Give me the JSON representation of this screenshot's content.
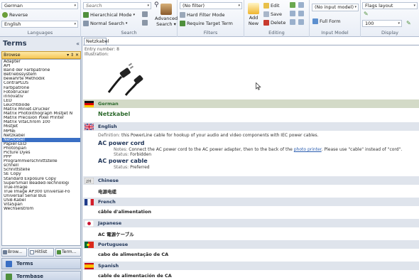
{
  "ribbon": {
    "languages": {
      "source_lang": "German",
      "reverse_label": "Reverse",
      "target_lang": "English",
      "group_label": "Languages"
    },
    "search": {
      "placeholder": "Search",
      "hierarchical_label": "Hierarchical Mode",
      "normal_search_label": "Normal Search",
      "advanced_label": "Advanced",
      "advanced_label2": "Search",
      "group_label": "Search"
    },
    "filters": {
      "filter_value": "(No filter)",
      "hard_filter_label": "Hard Filter Mode",
      "require_target_label": "Require Target Term",
      "group_label": "Filters"
    },
    "editing": {
      "add_label": "Add",
      "new_label": "New",
      "edit_label": "Edit",
      "save_label": "Save",
      "delete_label": "Delete",
      "group_label": "Editing"
    },
    "input_model": {
      "model_value": "(No input model)",
      "full_form_label": "Full Form",
      "group_label": "Input Model"
    },
    "display": {
      "layout_value": "Flags layout",
      "zoom_value": "100",
      "group_label": "Display"
    }
  },
  "leftpane": {
    "title": "Terms",
    "collapse_glyph": "«",
    "browse_label": "Browse",
    "browse_controls": "▾ ⇕ ✕",
    "items": [
      "Adapter",
      "API",
      "Band der Farbpatrone",
      "Betriebssystem",
      "bewährte Methodik",
      "ContraPLUS",
      "Farbpatrone",
      "Fotodrucker",
      "innovativ",
      "LED",
      "Leuchtdiode",
      "Matrix Miniet-Drucker",
      "Matrix Photolithograph MistJet N",
      "Matrix Precision Pixel Printer",
      "Matrix VitaChrom 100",
      "MistJet",
      "MPNE",
      "Netzkabel",
      "Netzkabel",
      "Papier-LED",
      "PhotoSpan",
      "Picture Dyes",
      "PPP",
      "Programmierschnittstelle",
      "schnell",
      "Schnittstelle",
      "SE Copy",
      "Standard Exposure Copy",
      "SuperSmall  Beaded-Technologi",
      "True-Image",
      "True Image AP300 Universal-Fo",
      "Universal Serial Bus",
      "USB-Kabel",
      "VitaSpan",
      "Wechselstrom"
    ],
    "selected_index": 18,
    "tabs": [
      "Brow...",
      "Hitlist",
      "Term..."
    ],
    "nav": [
      "Terms",
      "Termbase Management"
    ]
  },
  "main": {
    "tab_label": "Netzkabel",
    "entry_number": "Entry number:  8",
    "illustration_label": "Illustration:",
    "german": {
      "lang": "German",
      "term": "Netzkabel"
    },
    "english": {
      "lang": "English",
      "definition_key": "Definition:",
      "definition": "this PowerLine cable for hookup of your audio and video components with IEC power cables.",
      "term1": "AC power cord",
      "notes_key": "Notes:",
      "notes_pre": "Connect the AC power cord to the AC power adapter, then to the back of the",
      "notes_link": "photo printer",
      "notes_post": ". Please use \"cable\" instead of \"cord\".",
      "status_key": "Status:",
      "status1": "Forbidden",
      "term2": "AC power cable",
      "status2": "Preferred"
    },
    "chinese": {
      "lang": "Chinese",
      "term": "电源电缆"
    },
    "french": {
      "lang": "French",
      "term": "câble d'alimentation"
    },
    "japanese": {
      "lang": "Japanese",
      "term": "AC 電源ケーブル"
    },
    "portuguese": {
      "lang": "Portuguese",
      "term": "cabo de alimentação de CA"
    },
    "spanish": {
      "lang": "Spanish",
      "term": "cable de alimentación de CA"
    }
  },
  "colors": {
    "accent": "#3a6fc4",
    "browse_header": "#f7c856",
    "section_bar": "#dfe4ec"
  }
}
